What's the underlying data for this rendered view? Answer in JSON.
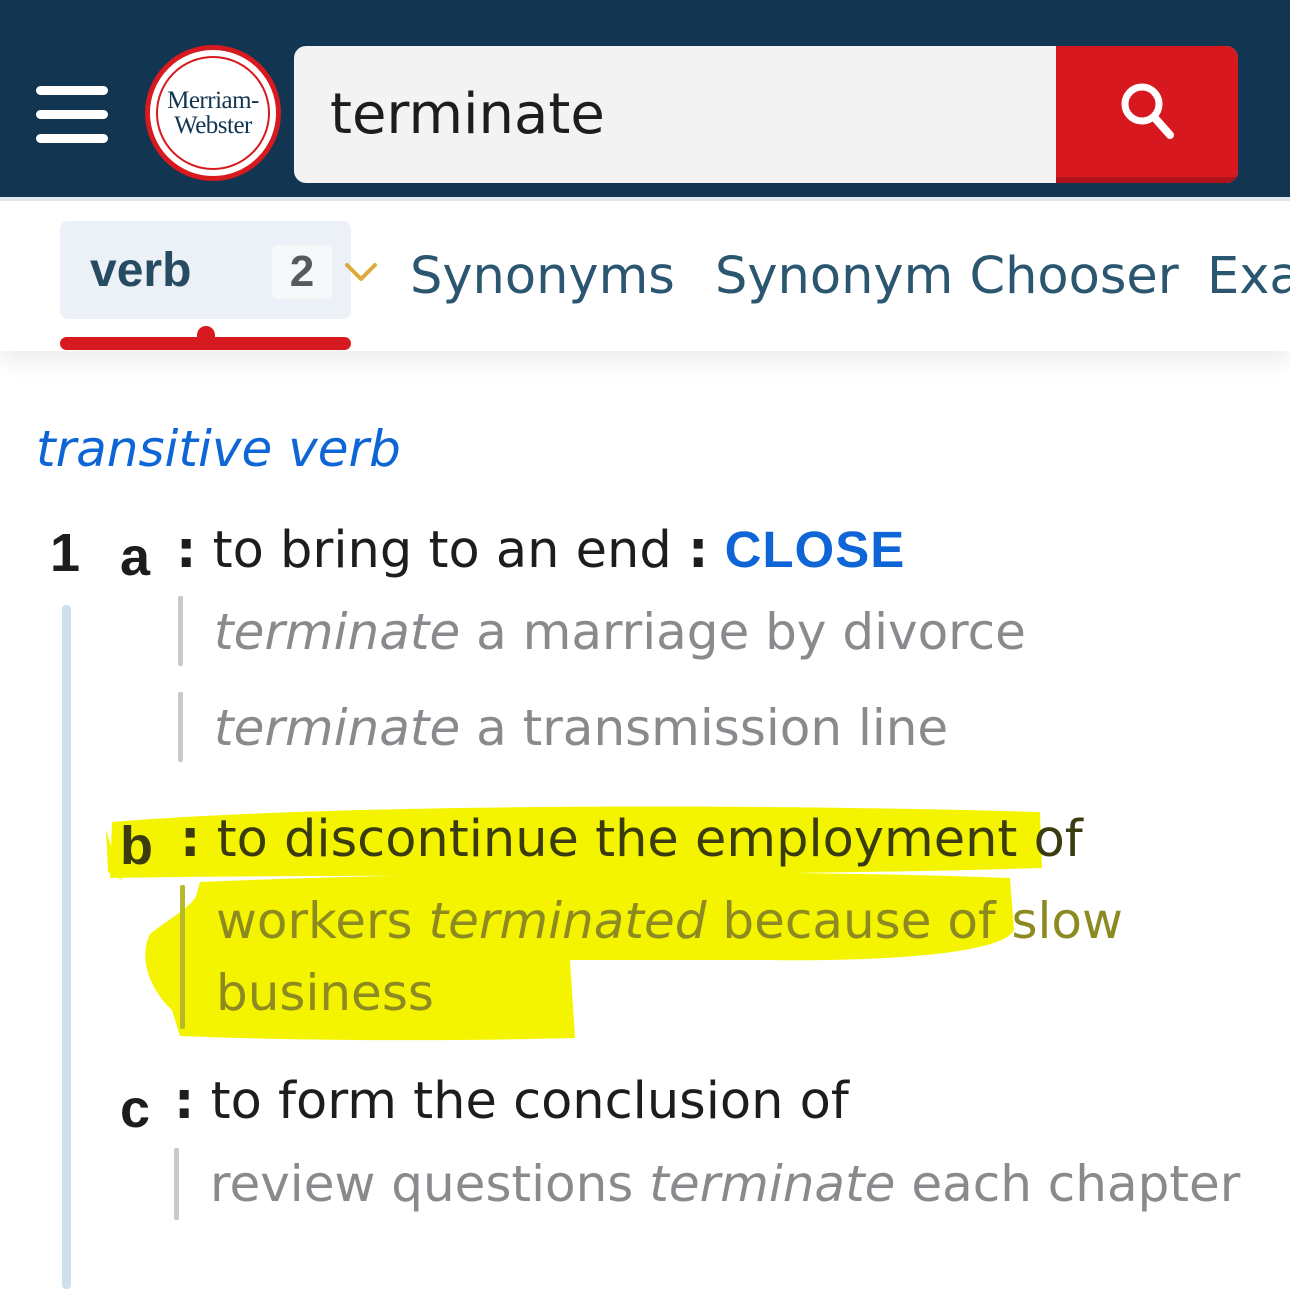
{
  "header": {
    "logo_line1": "Merriam-",
    "logo_line2": "Webster",
    "search_value": "terminate"
  },
  "tabs": {
    "pos_label": "verb",
    "pos_count": "2",
    "links": [
      "Synonyms",
      "Synonym Chooser",
      "Exa"
    ]
  },
  "entry": {
    "functional_label": "transitive verb",
    "sense_number": "1",
    "senses": [
      {
        "letter": "a",
        "colon": ":",
        "definition": "to bring to an end",
        "xref_colon": ":",
        "xref": "CLOSE",
        "examples": [
          {
            "italic": "terminate",
            "rest": " a marriage by divorce"
          },
          {
            "italic": "terminate",
            "rest": " a transmission line"
          }
        ]
      },
      {
        "letter": "b",
        "colon": ":",
        "definition": "to discontinue the employment of",
        "highlighted": true,
        "example": {
          "pre": "workers ",
          "italic": "terminated",
          "post": " because of slow",
          "line2": "business"
        }
      },
      {
        "letter": "c",
        "colon": ":",
        "definition": "to form the conclusion of",
        "example": {
          "pre": "review questions ",
          "italic": "terminate",
          "post": " each chapter"
        }
      }
    ]
  },
  "colors": {
    "header_bg": "#123551",
    "brand_red": "#d71920",
    "link_blue": "#0e65d6",
    "highlight": "#f4f400"
  },
  "icons": [
    "menu-icon",
    "search-icon",
    "chevron-down-icon"
  ]
}
